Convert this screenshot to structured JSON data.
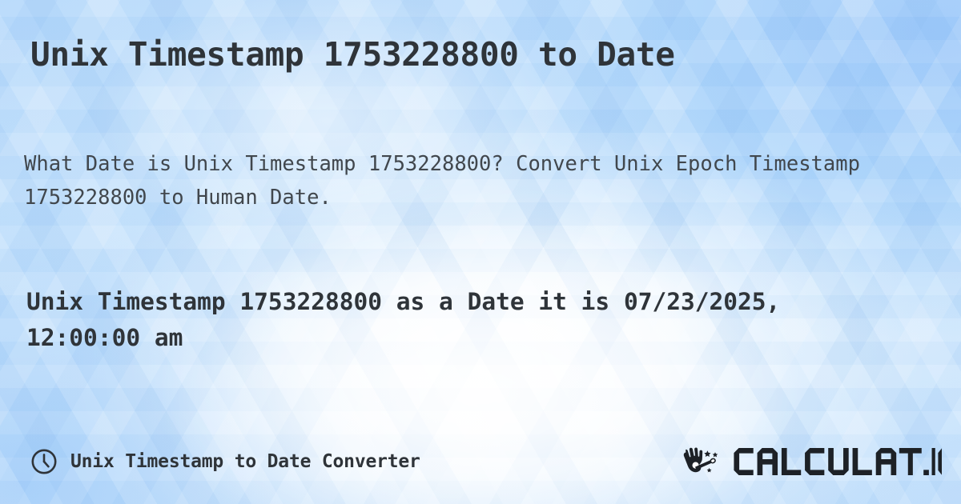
{
  "page": {
    "title": "Unix Timestamp 1753228800 to Date",
    "description": "What Date is Unix Timestamp 1753228800? Convert Unix Epoch Timestamp 1753228800 to Human Date.",
    "result": "Unix Timestamp 1753228800 as a Date it is 07/23/2025, 12:00:00 am"
  },
  "footer": {
    "icon": "clock-icon",
    "label": "Unix Timestamp to Date Converter"
  },
  "brand": {
    "icon": "magic-wand-hand-icon",
    "wordmark": "CALCULAT.IO"
  },
  "values": {
    "timestamp": "1753228800",
    "human_date": "07/23/2025, 12:00:00 am",
    "date_part": "07/23/2025",
    "time_part": "12:00:00 am"
  },
  "colors": {
    "text_dark": "#2f3439",
    "text_body": "#41474d",
    "background_blue": "#bcdcfb",
    "background_blue_deep": "#9ec9fa",
    "background_white": "#ffffff"
  }
}
